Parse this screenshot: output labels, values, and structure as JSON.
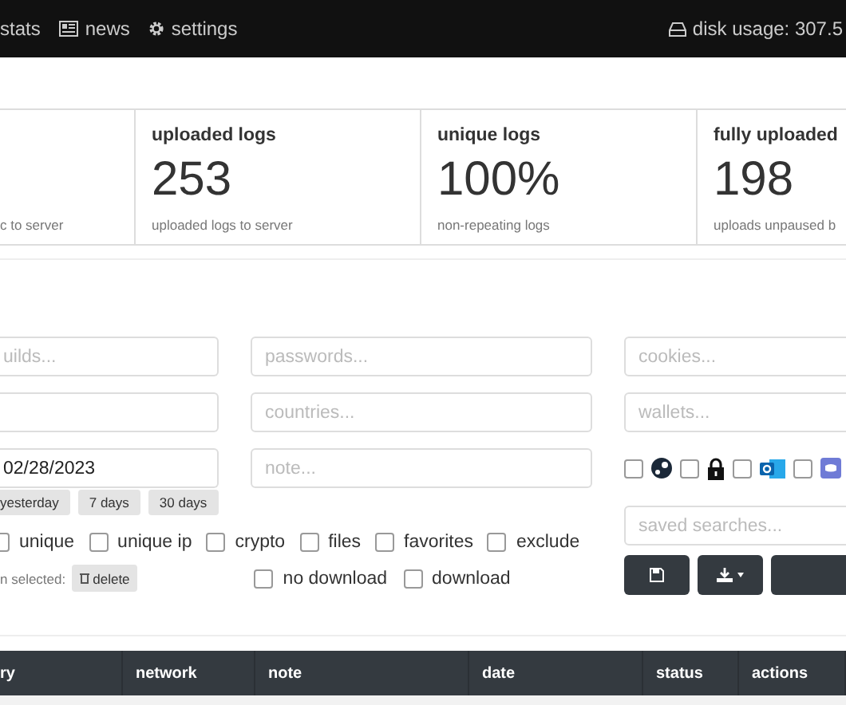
{
  "navbar": {
    "items": [
      {
        "label": "stats"
      },
      {
        "label": "news"
      },
      {
        "label": "settings"
      }
    ],
    "disk_usage": "disk usage: 307.5"
  },
  "stats": [
    {
      "subtitle": "c to server"
    },
    {
      "title": "uploaded logs",
      "value": "253",
      "subtitle": "uploaded logs to server"
    },
    {
      "title": "unique logs",
      "value": "100%",
      "subtitle": "non-repeating logs"
    },
    {
      "title": "fully uploaded",
      "value": "198",
      "subtitle": "uploads unpaused b"
    }
  ],
  "filters": {
    "fields": [
      {
        "kind": "text",
        "placeholder": "uilds..."
      },
      {
        "kind": "text",
        "placeholder": "passwords..."
      },
      {
        "kind": "text"
      },
      {
        "kind": "text",
        "placeholder": "countries..."
      },
      {
        "kind": "date",
        "value": "02/28/2023"
      },
      {
        "kind": "text",
        "placeholder": "note..."
      }
    ],
    "quick_ranges": [
      "yesterday",
      "7 days",
      "30 days"
    ],
    "options": [
      {
        "label": "unique",
        "checked": false
      },
      {
        "label": "unique ip",
        "checked": false
      },
      {
        "label": "crypto",
        "checked": false
      },
      {
        "label": "files",
        "checked": false
      },
      {
        "label": "favorites",
        "checked": false
      },
      {
        "label": "exclude",
        "checked": false
      }
    ],
    "selection_label": "n selected:",
    "delete_button": "delete",
    "download_options": [
      {
        "label": "no download",
        "checked": false
      },
      {
        "label": "download",
        "checked": false
      }
    ],
    "side_fields": [
      {
        "placeholder": "cookies..."
      },
      {
        "placeholder": "wallets..."
      }
    ],
    "icon_filters": [
      {
        "checked": false
      },
      {
        "checked": false
      },
      {
        "checked": false
      },
      {
        "checked": false
      }
    ],
    "saved_searches": {
      "placeholder": "saved searches..."
    }
  },
  "table": {
    "columns": [
      "ry",
      "network",
      "note",
      "date",
      "status",
      "actions"
    ]
  }
}
